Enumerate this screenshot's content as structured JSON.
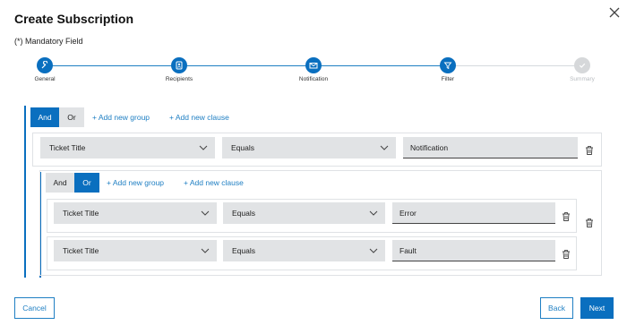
{
  "dialog": {
    "title": "Create Subscription",
    "mandatory": "(*) Mandatory Field"
  },
  "stepper": {
    "steps": [
      {
        "label": "General",
        "icon": "wrench-icon",
        "state": "active"
      },
      {
        "label": "Recipients",
        "icon": "contact-card-icon",
        "state": "active"
      },
      {
        "label": "Notification",
        "icon": "envelope-icon",
        "state": "active"
      },
      {
        "label": "Filter",
        "icon": "filter-icon",
        "state": "current"
      },
      {
        "label": "Summary",
        "icon": "check-icon",
        "state": "pending"
      }
    ]
  },
  "filter": {
    "outer": {
      "and_label": "And",
      "or_label": "Or",
      "selected": "And",
      "add_group": "+ Add new group",
      "add_clause": "+ Add new clause",
      "clause": {
        "field": "Ticket Title",
        "operator": "Equals",
        "value": "Notification"
      }
    },
    "inner": {
      "and_label": "And",
      "or_label": "Or",
      "selected": "Or",
      "add_group": "+ Add new group",
      "add_clause": "+ Add new clause",
      "clauses": [
        {
          "field": "Ticket Title",
          "operator": "Equals",
          "value": "Error"
        },
        {
          "field": "Ticket Title",
          "operator": "Equals",
          "value": "Fault"
        }
      ]
    }
  },
  "footer": {
    "cancel": "Cancel",
    "back": "Back",
    "next": "Next"
  },
  "colors": {
    "accent": "#0a6fbf",
    "link": "#1f7fc3",
    "field_bg": "#e1e3e5",
    "pending": "#d6d8da"
  }
}
